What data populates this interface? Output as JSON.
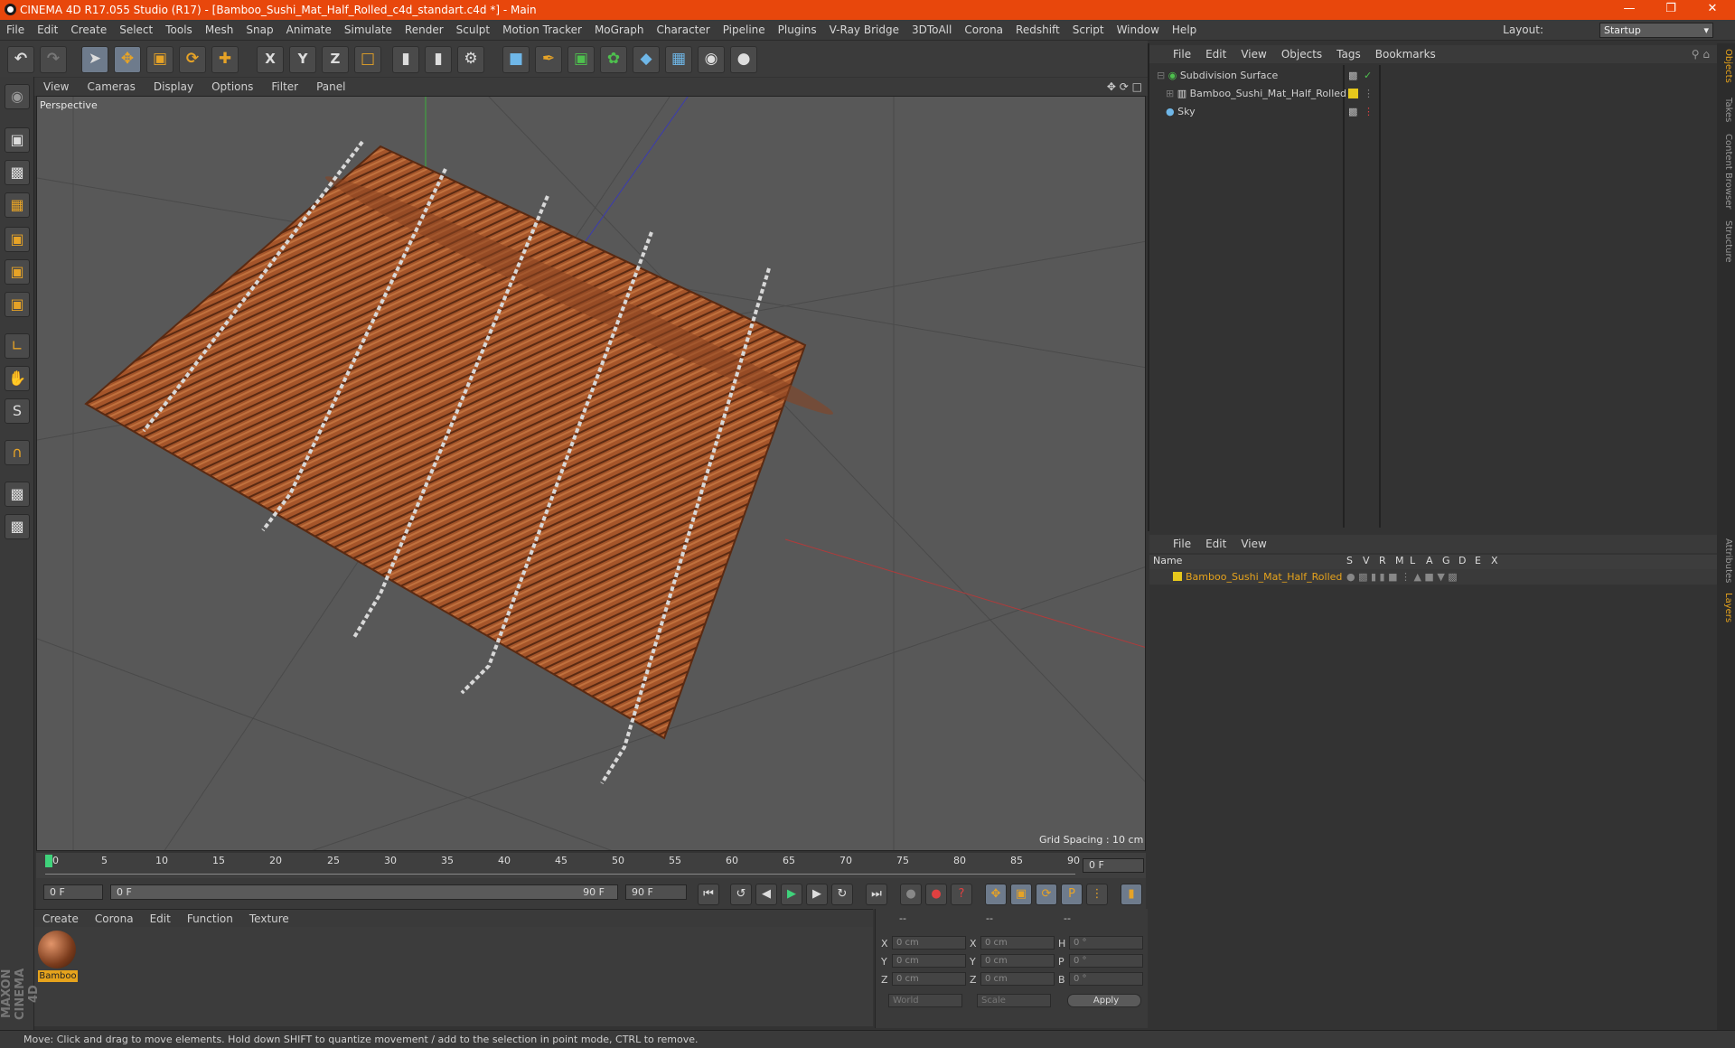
{
  "title_bar": {
    "text": "CINEMA 4D R17.055 Studio (R17) - [Bamboo_Sushi_Mat_Half_Rolled_c4d_standart.c4d *] - Main"
  },
  "menu": [
    "File",
    "Edit",
    "Create",
    "Select",
    "Tools",
    "Mesh",
    "Snap",
    "Animate",
    "Simulate",
    "Render",
    "Sculpt",
    "Motion Tracker",
    "MoGraph",
    "Character",
    "Pipeline",
    "Plugins",
    "V-Ray Bridge",
    "3DToAll",
    "Corona",
    "Redshift",
    "Script",
    "Window",
    "Help"
  ],
  "layout": {
    "label": "Layout:",
    "value": "Startup"
  },
  "toolbar": {
    "axis_x": "X",
    "axis_y": "Y",
    "axis_z": "Z"
  },
  "viewport": {
    "menu": [
      "View",
      "Cameras",
      "Display",
      "Options",
      "Filter",
      "Panel"
    ],
    "label": "Perspective",
    "grid_spacing": "Grid Spacing : 10 cm"
  },
  "timeline": {
    "ticks": [
      "0",
      "5",
      "10",
      "15",
      "20",
      "25",
      "30",
      "35",
      "40",
      "45",
      "50",
      "55",
      "60",
      "65",
      "70",
      "75",
      "80",
      "85",
      "90"
    ],
    "current_frame": "0 F",
    "start_field": "0 F",
    "range_start": "0 F",
    "range_end": "90 F",
    "end_field": "90 F"
  },
  "material_manager": {
    "menu": [
      "Create",
      "Corona",
      "Edit",
      "Function",
      "Texture"
    ],
    "materials": [
      {
        "name": "Bamboo"
      }
    ]
  },
  "coordinates": {
    "header": [
      "--",
      "--",
      "--"
    ],
    "rows": [
      {
        "l1": "X",
        "v1": "0 cm",
        "l2": "X",
        "v2": "0 cm",
        "l3": "H",
        "v3": "0 °"
      },
      {
        "l1": "Y",
        "v1": "0 cm",
        "l2": "Y",
        "v2": "0 cm",
        "l3": "P",
        "v3": "0 °"
      },
      {
        "l1": "Z",
        "v1": "0 cm",
        "l2": "Z",
        "v2": "0 cm",
        "l3": "B",
        "v3": "0 °"
      }
    ],
    "mode": "World",
    "size_mode": "Scale",
    "apply": "Apply"
  },
  "object_manager": {
    "menu": [
      "File",
      "Edit",
      "View",
      "Objects",
      "Tags",
      "Bookmarks"
    ],
    "objects": [
      {
        "name": "Subdivision Surface"
      },
      {
        "name": "Bamboo_Sushi_Mat_Half_Rolled"
      },
      {
        "name": "Sky"
      }
    ]
  },
  "layer_manager": {
    "menu": [
      "File",
      "Edit",
      "View"
    ],
    "columns": [
      "Name",
      "S",
      "V",
      "R",
      "M",
      "L",
      "A",
      "G",
      "D",
      "E",
      "X"
    ],
    "layers": [
      {
        "name": "Bamboo_Sushi_Mat_Half_Rolled",
        "color": "#e6c81c"
      }
    ]
  },
  "side_tabs": [
    "Objects",
    "Takes",
    "Content Browser",
    "Structure",
    "Attributes",
    "Layers"
  ],
  "status": "Move: Click and drag to move elements. Hold down SHIFT to quantize movement / add to the selection in point mode, CTRL to remove.",
  "maxon": "MAXON CINEMA 4D"
}
